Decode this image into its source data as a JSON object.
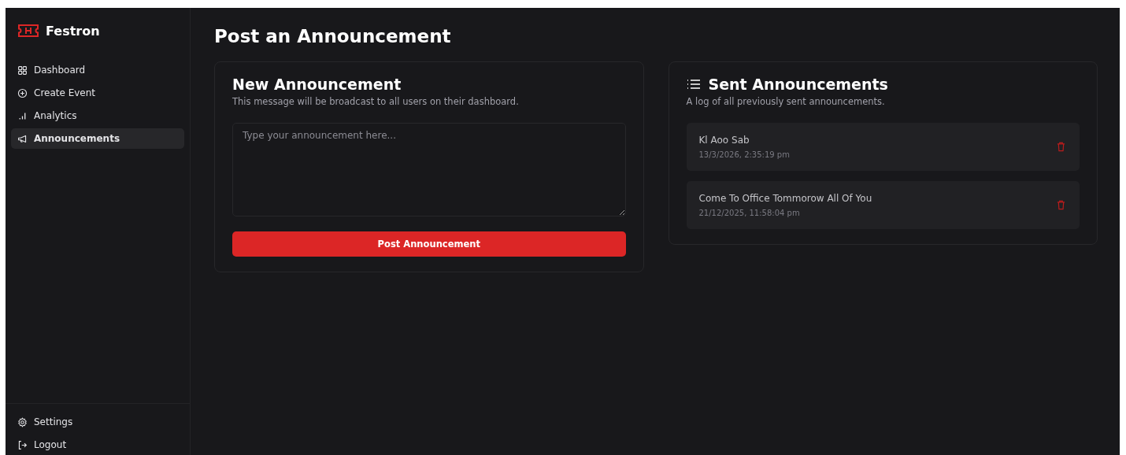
{
  "brand": {
    "name": "Festron"
  },
  "nav": [
    {
      "label": "Dashboard",
      "kind": "grid",
      "selected": false
    },
    {
      "label": "Create Event",
      "kind": "plus",
      "selected": false
    },
    {
      "label": "Analytics",
      "kind": "chart",
      "selected": false
    },
    {
      "label": "Announcements",
      "kind": "megaphone",
      "selected": true
    }
  ],
  "footer_nav": [
    {
      "label": "Settings",
      "kind": "gear"
    },
    {
      "label": "Logout",
      "kind": "logout"
    }
  ],
  "page_title": "Post an Announcement",
  "composer": {
    "title": "New Announcement",
    "subtitle": "This message will be broadcast to all users on their dashboard.",
    "placeholder": "Type your announcement here...",
    "button": "Post Announcement"
  },
  "sent": {
    "title": "Sent Announcements",
    "subtitle": "A log of all previously sent announcements.",
    "items": [
      {
        "message": "Kl Aoo Sab",
        "time": "13/3/2026, 2:35:19 pm"
      },
      {
        "message": "Come To Office Tommorow All Of You",
        "time": "21/12/2025, 11:58:04 pm"
      }
    ]
  }
}
